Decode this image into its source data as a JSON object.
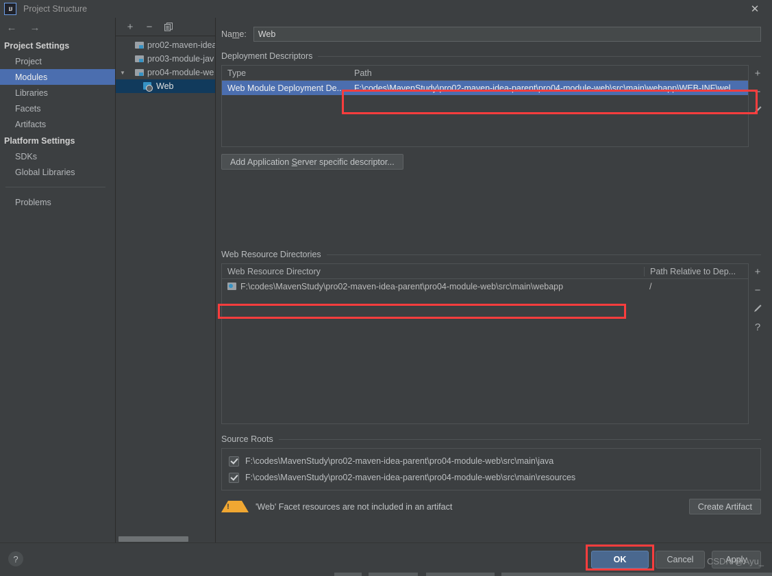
{
  "window": {
    "title": "Project Structure",
    "logo_text": "IJ",
    "close_label": "✕"
  },
  "nav": {
    "back_icon": "←",
    "forward_icon": "→",
    "groups": [
      {
        "title": "Project Settings",
        "items": [
          {
            "label": "Project",
            "selected": false
          },
          {
            "label": "Modules",
            "selected": true
          },
          {
            "label": "Libraries",
            "selected": false
          },
          {
            "label": "Facets",
            "selected": false
          },
          {
            "label": "Artifacts",
            "selected": false
          }
        ]
      },
      {
        "title": "Platform Settings",
        "items": [
          {
            "label": "SDKs",
            "selected": false
          },
          {
            "label": "Global Libraries",
            "selected": false
          }
        ]
      }
    ],
    "problems_label": "Problems"
  },
  "tree": {
    "toolbar": {
      "add": "+",
      "remove": "−",
      "copy": "copy-icon"
    },
    "nodes": [
      {
        "label": "pro02-maven-idea",
        "icon": "module-folder-icon",
        "depth": 1,
        "twisty": "",
        "selected": false
      },
      {
        "label": "pro03-module-jav",
        "icon": "module-folder-icon",
        "depth": 1,
        "twisty": "",
        "selected": false
      },
      {
        "label": "pro04-module-we",
        "icon": "module-folder-icon",
        "depth": 1,
        "twisty": "▼",
        "selected": false
      },
      {
        "label": "Web",
        "icon": "web-facet-icon",
        "depth": 2,
        "twisty": "",
        "selected": true
      }
    ]
  },
  "facet": {
    "name_label": "Na",
    "name_label_mnemonic": "m",
    "name_label_tail": "e:",
    "name_value": "Web",
    "deployment_descriptors": {
      "section_title": "Deployment Descriptors",
      "columns": [
        "Type",
        "Path"
      ],
      "rows": [
        {
          "type": "Web Module Deployment De..",
          "path": "F:\\codes\\MavenStudy\\pro02-maven-idea-parent\\pro04-module-web\\src\\main\\webapp\\WEB-INF\\wel",
          "selected": true
        }
      ],
      "tools": [
        "+",
        "−",
        "pencil-icon"
      ]
    },
    "add_descriptor_button": {
      "pre": "Add Application ",
      "mnemonic": "S",
      "post": "erver specific descriptor..."
    },
    "web_resource_directories": {
      "section_title": "Web Resource Directories",
      "columns": [
        "Web Resource Directory",
        "Path Relative to Dep..."
      ],
      "rows": [
        {
          "directory": "F:\\codes\\MavenStudy\\pro02-maven-idea-parent\\pro04-module-web\\src\\main\\webapp",
          "relative": "/"
        }
      ],
      "tools": [
        "+",
        "−",
        "pencil-icon",
        "?"
      ]
    },
    "source_roots": {
      "section_title": "Source Roots",
      "rows": [
        {
          "path": "F:\\codes\\MavenStudy\\pro02-maven-idea-parent\\pro04-module-web\\src\\main\\java",
          "checked": true
        },
        {
          "path": "F:\\codes\\MavenStudy\\pro02-maven-idea-parent\\pro04-module-web\\src\\main\\resources",
          "checked": true
        }
      ]
    },
    "warning": {
      "icon": "warning-triangle-icon",
      "text": "'Web' Facet resources are not included in an artifact",
      "action_label": "Create Artifact"
    }
  },
  "footer": {
    "help_icon": "?",
    "ok_label": "OK",
    "cancel_label": "Cancel",
    "apply_label": "Apply"
  },
  "overlay": {
    "watermark": "CSDN @Ayu_",
    "highlight_color": "#fc3d3d"
  }
}
